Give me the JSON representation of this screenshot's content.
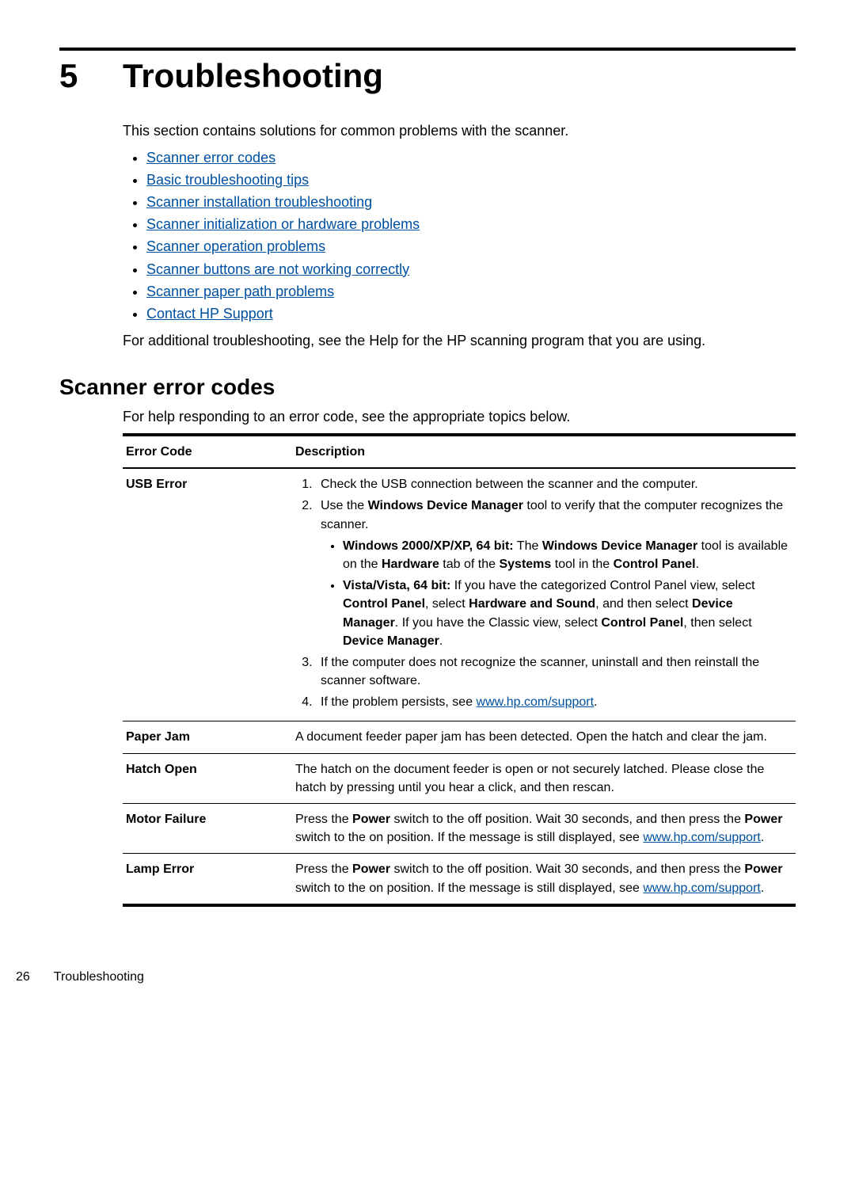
{
  "chapter": {
    "number": "5",
    "title": "Troubleshooting"
  },
  "intro": "This section contains solutions for common problems with the scanner.",
  "topics": [
    "Scanner error codes",
    "Basic troubleshooting tips",
    "Scanner installation troubleshooting",
    "Scanner initialization or hardware problems",
    "Scanner operation problems",
    "Scanner buttons are not working correctly",
    "Scanner paper path problems",
    "Contact HP Support"
  ],
  "additional": "For additional troubleshooting, see the Help for the HP scanning program that you are using.",
  "section_heading": "Scanner error codes",
  "section_intro": "For help responding to an error code, see the appropriate topics below.",
  "table": {
    "headers": {
      "code": "Error Code",
      "desc": "Description"
    },
    "rows": {
      "usb": {
        "code": "USB Error",
        "step1": "Check the USB connection between the scanner and the computer.",
        "step2_pre": "Use the ",
        "step2_b1": "Windows Device Manager",
        "step2_post": " tool to verify that the computer recognizes the scanner.",
        "sub1_b1": "Windows 2000/XP/XP, 64 bit:",
        "sub1_t1": " The ",
        "sub1_b2": "Windows Device Manager",
        "sub1_t2": " tool is available on the ",
        "sub1_b3": "Hardware",
        "sub1_t3": " tab of the ",
        "sub1_b4": "Systems",
        "sub1_t4": " tool in the ",
        "sub1_b5": "Control Panel",
        "sub1_t5": ".",
        "sub2_b1": "Vista/Vista, 64 bit:",
        "sub2_t1": " If you have the categorized Control Panel view, select ",
        "sub2_b2": "Control Panel",
        "sub2_t2": ", select ",
        "sub2_b3": "Hardware and Sound",
        "sub2_t3": ", and then select ",
        "sub2_b4": "Device Manager",
        "sub2_t4": ". If you have the Classic view, select ",
        "sub2_b5": "Control Panel",
        "sub2_t5": ", then select ",
        "sub2_b6": "Device Manager",
        "sub2_t6": ".",
        "step3": "If the computer does not recognize the scanner, uninstall and then reinstall the scanner software.",
        "step4_pre": "If the problem persists, see ",
        "step4_link": "www.hp.com/support",
        "step4_post": "."
      },
      "paperjam": {
        "code": "Paper Jam",
        "desc": "A document feeder paper jam has been detected. Open the hatch and clear the jam."
      },
      "hatch": {
        "code": "Hatch Open",
        "desc": "The hatch on the document feeder is open or not securely latched. Please close the hatch by pressing until you hear a click, and then rescan."
      },
      "motor": {
        "code": "Motor Failure",
        "t1": "Press the ",
        "b1": "Power",
        "t2": " switch to the off position. Wait 30 seconds, and then press the ",
        "b2": "Power",
        "t3": " switch to the on position. If the message is still displayed, see ",
        "link": "www.hp.com/support",
        "t4": "."
      },
      "lamp": {
        "code": "Lamp Error",
        "t1": "Press the ",
        "b1": "Power",
        "t2": " switch to the off position. Wait 30 seconds, and then press the ",
        "b2": "Power",
        "t3": " switch to the on position. If the message is still displayed, see ",
        "link": "www.hp.com/support",
        "t4": "."
      }
    }
  },
  "footer": {
    "page": "26",
    "title": "Troubleshooting"
  }
}
